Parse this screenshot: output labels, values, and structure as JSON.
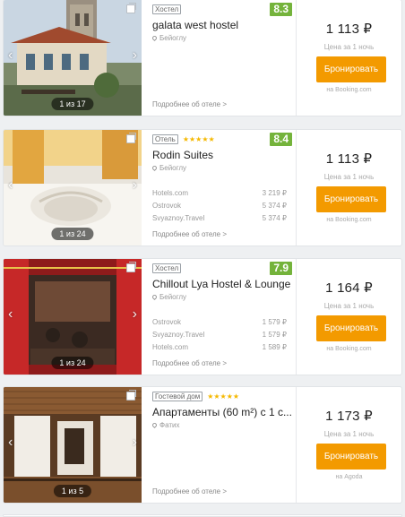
{
  "ui": {
    "details_link": "Подробнее об отеле >",
    "per_night": "Цена за 1 ночь",
    "book_button": "Бронировать",
    "arrow_left": "‹",
    "arrow_right": "›"
  },
  "hotels": [
    {
      "type": "Хостел",
      "stars": "",
      "rating": "8.3",
      "name": "galata west hostel",
      "location": "Бейоглу",
      "photo_counter": "1 из 17",
      "offers": [],
      "price": "1 113 ₽",
      "source": "на Booking.com"
    },
    {
      "type": "Отель",
      "stars": "★★★★★",
      "rating": "8.4",
      "name": "Rodin Suites",
      "location": "Бейоглу",
      "photo_counter": "1 из 24",
      "offers": [
        {
          "site": "Hotels.com",
          "price": "3 219 ₽"
        },
        {
          "site": "Ostrovok",
          "price": "5 374 ₽"
        },
        {
          "site": "Svyaznoy.Travel",
          "price": "5 374 ₽"
        }
      ],
      "price": "1 113 ₽",
      "source": "на Booking.com"
    },
    {
      "type": "Хостел",
      "stars": "",
      "rating": "7.9",
      "name": "Chillout Lya Hostel & Lounge",
      "location": "Бейоглу",
      "photo_counter": "1 из 24",
      "offers": [
        {
          "site": "Ostrovok",
          "price": "1 579 ₽"
        },
        {
          "site": "Svyaznoy.Travel",
          "price": "1 579 ₽"
        },
        {
          "site": "Hotels.com",
          "price": "1 589 ₽"
        }
      ],
      "price": "1 164 ₽",
      "source": "на Booking.com"
    },
    {
      "type": "Гостевой дом",
      "stars": "★★★★★",
      "rating": "",
      "name": "Апартаменты (60 m²) с 1 с...",
      "location": "Фатих",
      "photo_counter": "1 из 5",
      "offers": [],
      "price": "1 173 ₽",
      "source": "на Agoda"
    }
  ]
}
